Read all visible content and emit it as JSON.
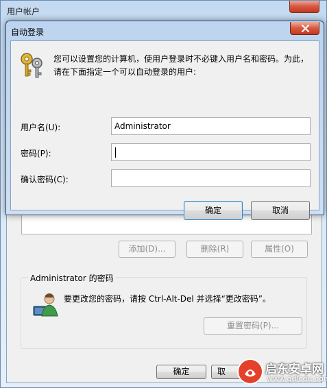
{
  "background_window": {
    "title": "用户帐户",
    "buttons": {
      "add": "添加(D)...",
      "remove": "删除(R)",
      "properties": "属性(O)"
    },
    "password_group": {
      "label": "Administrator 的密码",
      "text": "要更改您的密码，请按 Ctrl-Alt-Del 并选择“更改密码”。",
      "reset_button": "重置密码(P)..."
    },
    "ok_button": "确定",
    "cancel_button_partial": "取"
  },
  "dialog": {
    "title": "自动登录",
    "description_line1": "您可以设置您的计算机，使用户登录时不必键入用户名和密码。为此，",
    "description_line2": "请在下面指定一个可以自动登录的用户:",
    "fields": {
      "username": {
        "label": "用户名(U):",
        "value": "Administrator"
      },
      "password": {
        "label": "密码(P):",
        "value": ""
      },
      "confirm_password": {
        "label": "确认密码(C):",
        "value": ""
      }
    },
    "ok_button": "确定",
    "cancel_button": "取消"
  },
  "watermark": {
    "name": "启东安卓网",
    "url": "www.qdlcdu.com"
  },
  "colors": {
    "window_frame": "#c4daf1",
    "close_button": "#d9553e",
    "dialog_body": "#f0f0f0",
    "default_button_border": "#3c7fb1"
  }
}
